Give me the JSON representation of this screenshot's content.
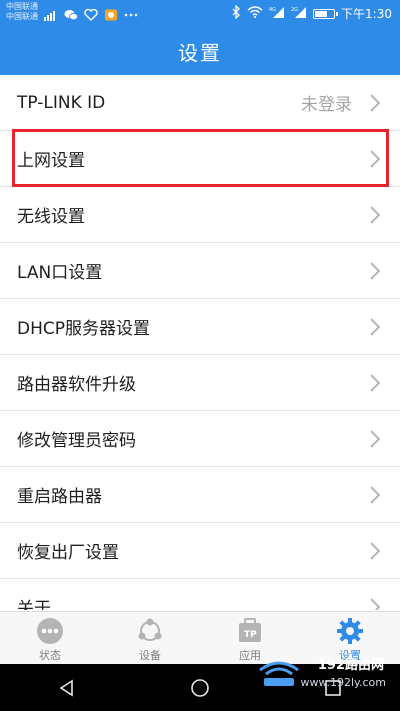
{
  "status_bar": {
    "carrier_1": "中国联通",
    "carrier_2": "中国联通",
    "time": "下午1:30",
    "signal_tags": [
      "4G",
      "2G"
    ]
  },
  "header": {
    "title": "设置"
  },
  "settings": {
    "items": [
      {
        "label": "TP-LINK ID",
        "value": "未登录"
      },
      {
        "label": "上网设置",
        "value": ""
      },
      {
        "label": "无线设置",
        "value": ""
      },
      {
        "label": "LAN口设置",
        "value": ""
      },
      {
        "label": "DHCP服务器设置",
        "value": ""
      },
      {
        "label": "路由器软件升级",
        "value": ""
      },
      {
        "label": "修改管理员密码",
        "value": ""
      },
      {
        "label": "重启路由器",
        "value": ""
      },
      {
        "label": "恢复出厂设置",
        "value": ""
      },
      {
        "label": "关于",
        "value": ""
      }
    ]
  },
  "tabs": [
    {
      "label": "状态",
      "icon": "more-dots-icon"
    },
    {
      "label": "设备",
      "icon": "device-share-icon"
    },
    {
      "label": "应用",
      "icon": "tp-app-icon"
    },
    {
      "label": "设置",
      "icon": "gear-icon",
      "active": true
    }
  ],
  "watermark": {
    "brand": "192路由网",
    "url": "www.192ly.com"
  },
  "colors": {
    "primary": "#2f8be8",
    "highlight": "#e8232b",
    "tab_inactive": "#7d7d7d"
  }
}
